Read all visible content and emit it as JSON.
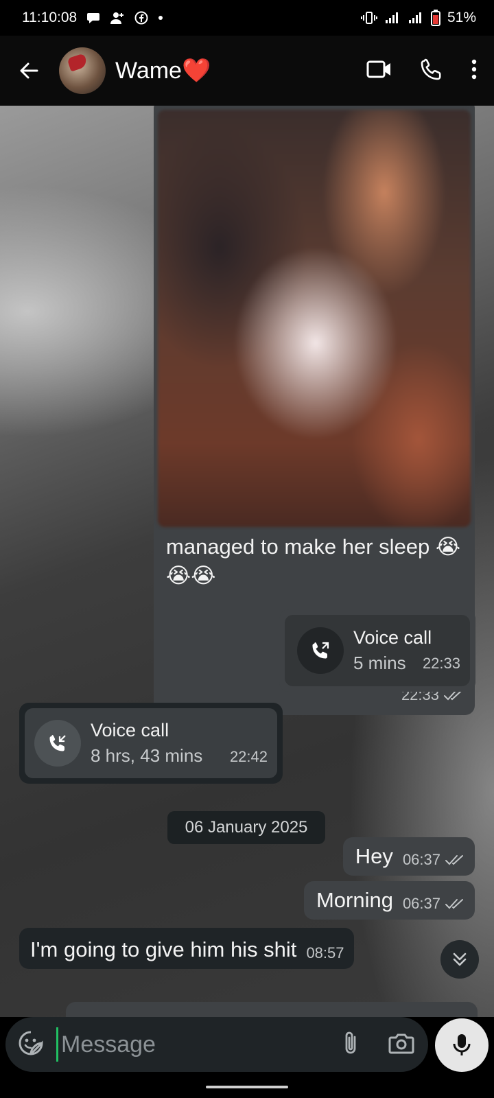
{
  "status_bar": {
    "time": "11:10:08",
    "battery": "51%",
    "left_icons": [
      "chat-bubble-icon",
      "add-person-icon",
      "facebook-icon",
      "dot-icon"
    ],
    "right_icons": [
      "vibrate-icon",
      "signal-icon",
      "signal-icon",
      "battery-icon"
    ]
  },
  "header": {
    "contact_name": "Wame❤️",
    "actions": [
      "video-call-icon",
      "voice-call-icon",
      "more-options-icon"
    ]
  },
  "messages": {
    "photo": {
      "caption": "managed to make her sleep 😭😭😭",
      "time": "22:33",
      "status": "read"
    },
    "call_out": {
      "title": "Voice call",
      "duration": "5 mins",
      "time": "22:33"
    },
    "call_in": {
      "title": "Voice call",
      "duration": "8 hrs, 43 mins",
      "time": "22:42"
    },
    "date_divider": "06 January 2025",
    "hey": {
      "text": "Hey",
      "time": "06:37",
      "status": "read"
    },
    "morning": {
      "text": "Morning",
      "time": "06:37",
      "status": "read"
    },
    "shit": {
      "text": "I'm going to give him his shit",
      "time": "08:57"
    }
  },
  "composer": {
    "placeholder": "Message"
  },
  "colors": {
    "outgoing_bubble": "#3f4245",
    "incoming_bubble": "#1f2427",
    "cursor": "#21c063",
    "read_ticks": "#c3c6c8"
  }
}
